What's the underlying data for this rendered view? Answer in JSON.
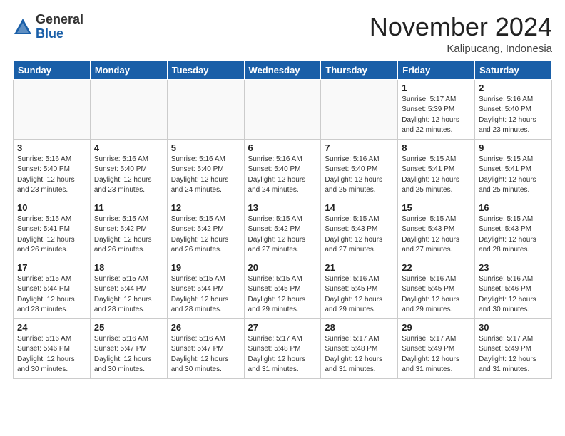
{
  "logo": {
    "general": "General",
    "blue": "Blue"
  },
  "title": "November 2024",
  "location": "Kalipucang, Indonesia",
  "weekdays": [
    "Sunday",
    "Monday",
    "Tuesday",
    "Wednesday",
    "Thursday",
    "Friday",
    "Saturday"
  ],
  "weeks": [
    [
      {
        "day": "",
        "detail": ""
      },
      {
        "day": "",
        "detail": ""
      },
      {
        "day": "",
        "detail": ""
      },
      {
        "day": "",
        "detail": ""
      },
      {
        "day": "",
        "detail": ""
      },
      {
        "day": "1",
        "detail": "Sunrise: 5:17 AM\nSunset: 5:39 PM\nDaylight: 12 hours\nand 22 minutes."
      },
      {
        "day": "2",
        "detail": "Sunrise: 5:16 AM\nSunset: 5:40 PM\nDaylight: 12 hours\nand 23 minutes."
      }
    ],
    [
      {
        "day": "3",
        "detail": "Sunrise: 5:16 AM\nSunset: 5:40 PM\nDaylight: 12 hours\nand 23 minutes."
      },
      {
        "day": "4",
        "detail": "Sunrise: 5:16 AM\nSunset: 5:40 PM\nDaylight: 12 hours\nand 23 minutes."
      },
      {
        "day": "5",
        "detail": "Sunrise: 5:16 AM\nSunset: 5:40 PM\nDaylight: 12 hours\nand 24 minutes."
      },
      {
        "day": "6",
        "detail": "Sunrise: 5:16 AM\nSunset: 5:40 PM\nDaylight: 12 hours\nand 24 minutes."
      },
      {
        "day": "7",
        "detail": "Sunrise: 5:16 AM\nSunset: 5:40 PM\nDaylight: 12 hours\nand 25 minutes."
      },
      {
        "day": "8",
        "detail": "Sunrise: 5:15 AM\nSunset: 5:41 PM\nDaylight: 12 hours\nand 25 minutes."
      },
      {
        "day": "9",
        "detail": "Sunrise: 5:15 AM\nSunset: 5:41 PM\nDaylight: 12 hours\nand 25 minutes."
      }
    ],
    [
      {
        "day": "10",
        "detail": "Sunrise: 5:15 AM\nSunset: 5:41 PM\nDaylight: 12 hours\nand 26 minutes."
      },
      {
        "day": "11",
        "detail": "Sunrise: 5:15 AM\nSunset: 5:42 PM\nDaylight: 12 hours\nand 26 minutes."
      },
      {
        "day": "12",
        "detail": "Sunrise: 5:15 AM\nSunset: 5:42 PM\nDaylight: 12 hours\nand 26 minutes."
      },
      {
        "day": "13",
        "detail": "Sunrise: 5:15 AM\nSunset: 5:42 PM\nDaylight: 12 hours\nand 27 minutes."
      },
      {
        "day": "14",
        "detail": "Sunrise: 5:15 AM\nSunset: 5:43 PM\nDaylight: 12 hours\nand 27 minutes."
      },
      {
        "day": "15",
        "detail": "Sunrise: 5:15 AM\nSunset: 5:43 PM\nDaylight: 12 hours\nand 27 minutes."
      },
      {
        "day": "16",
        "detail": "Sunrise: 5:15 AM\nSunset: 5:43 PM\nDaylight: 12 hours\nand 28 minutes."
      }
    ],
    [
      {
        "day": "17",
        "detail": "Sunrise: 5:15 AM\nSunset: 5:44 PM\nDaylight: 12 hours\nand 28 minutes."
      },
      {
        "day": "18",
        "detail": "Sunrise: 5:15 AM\nSunset: 5:44 PM\nDaylight: 12 hours\nand 28 minutes."
      },
      {
        "day": "19",
        "detail": "Sunrise: 5:15 AM\nSunset: 5:44 PM\nDaylight: 12 hours\nand 28 minutes."
      },
      {
        "day": "20",
        "detail": "Sunrise: 5:15 AM\nSunset: 5:45 PM\nDaylight: 12 hours\nand 29 minutes."
      },
      {
        "day": "21",
        "detail": "Sunrise: 5:16 AM\nSunset: 5:45 PM\nDaylight: 12 hours\nand 29 minutes."
      },
      {
        "day": "22",
        "detail": "Sunrise: 5:16 AM\nSunset: 5:45 PM\nDaylight: 12 hours\nand 29 minutes."
      },
      {
        "day": "23",
        "detail": "Sunrise: 5:16 AM\nSunset: 5:46 PM\nDaylight: 12 hours\nand 30 minutes."
      }
    ],
    [
      {
        "day": "24",
        "detail": "Sunrise: 5:16 AM\nSunset: 5:46 PM\nDaylight: 12 hours\nand 30 minutes."
      },
      {
        "day": "25",
        "detail": "Sunrise: 5:16 AM\nSunset: 5:47 PM\nDaylight: 12 hours\nand 30 minutes."
      },
      {
        "day": "26",
        "detail": "Sunrise: 5:16 AM\nSunset: 5:47 PM\nDaylight: 12 hours\nand 30 minutes."
      },
      {
        "day": "27",
        "detail": "Sunrise: 5:17 AM\nSunset: 5:48 PM\nDaylight: 12 hours\nand 31 minutes."
      },
      {
        "day": "28",
        "detail": "Sunrise: 5:17 AM\nSunset: 5:48 PM\nDaylight: 12 hours\nand 31 minutes."
      },
      {
        "day": "29",
        "detail": "Sunrise: 5:17 AM\nSunset: 5:49 PM\nDaylight: 12 hours\nand 31 minutes."
      },
      {
        "day": "30",
        "detail": "Sunrise: 5:17 AM\nSunset: 5:49 PM\nDaylight: 12 hours\nand 31 minutes."
      }
    ]
  ]
}
